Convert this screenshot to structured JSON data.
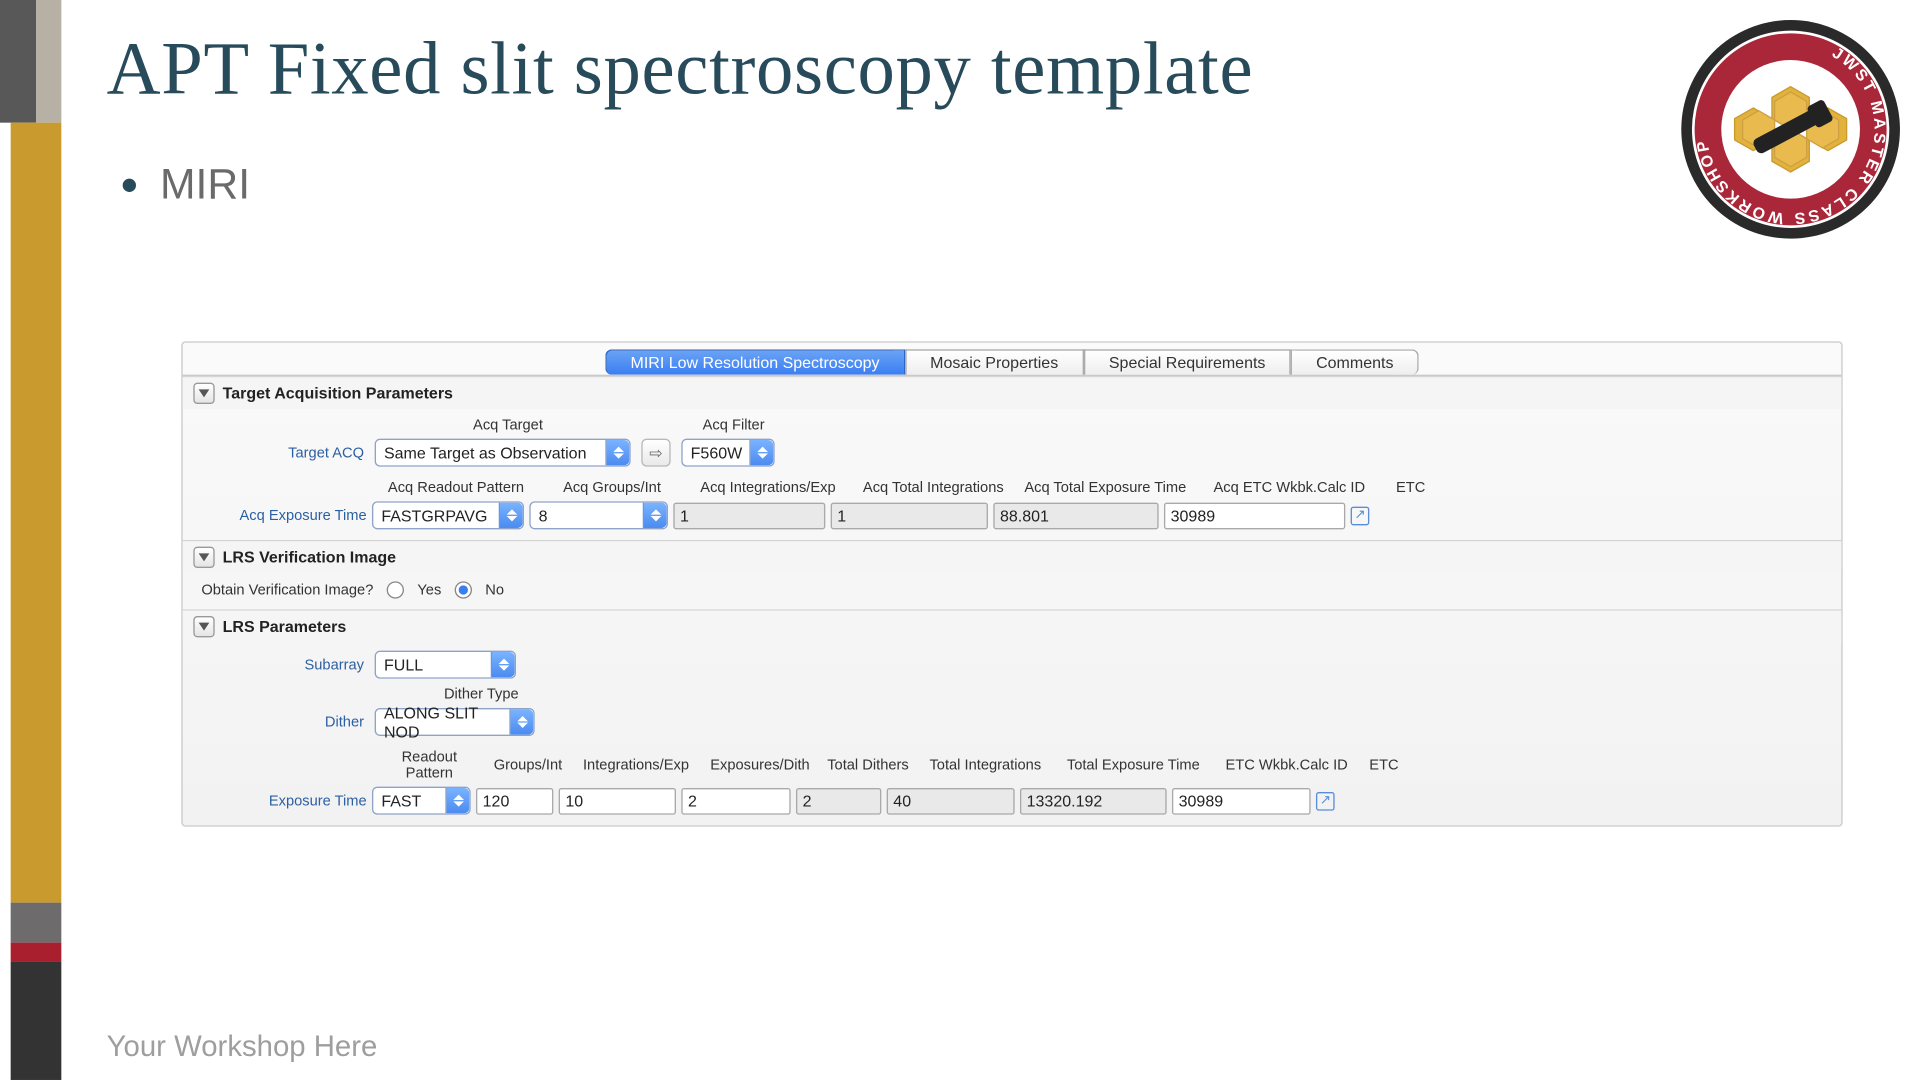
{
  "title": "APT Fixed slit spectroscopy template",
  "bullet": "MIRI",
  "footer": "Your Workshop Here",
  "logo_text": "JWST MASTER CLASS WORKSHOP",
  "tabs": {
    "main": "MIRI Low Resolution Spectroscopy",
    "mosaic": "Mosaic Properties",
    "special": "Special Requirements",
    "comments": "Comments"
  },
  "acq": {
    "section_title": "Target Acquisition Parameters",
    "target_label": "Acq Target",
    "filter_label": "Acq Filter",
    "target_acq_label": "Target ACQ",
    "target_acq_value": "Same Target as Observation",
    "filter_value": "F560W",
    "exposure_time_label": "Acq Exposure Time",
    "headers": {
      "readout": "Acq Readout Pattern",
      "groups": "Acq Groups/Int",
      "ints_exp": "Acq Integrations/Exp",
      "total_ints": "Acq Total Integrations",
      "total_exp": "Acq Total Exposure Time",
      "calc_id": "Acq ETC Wkbk.Calc ID",
      "etc": "ETC"
    },
    "values": {
      "readout": "FASTGRPAVG",
      "groups": "8",
      "ints_exp": "1",
      "total_ints": "1",
      "total_exp": "88.801",
      "calc_id": "30989"
    }
  },
  "verify": {
    "section_title": "LRS Verification Image",
    "obtain_label": "Obtain Verification Image?",
    "yes": "Yes",
    "no": "No",
    "selected": "No"
  },
  "lrs": {
    "section_title": "LRS Parameters",
    "subarray_label": "Subarray",
    "subarray_value": "FULL",
    "dither_type_label": "Dither Type",
    "dither_label": "Dither",
    "dither_value": "ALONG SLIT NOD",
    "exposure_time_label": "Exposure Time",
    "headers": {
      "readout": "Readout Pattern",
      "groups": "Groups/Int",
      "ints_exp": "Integrations/Exp",
      "exp_dith": "Exposures/Dith",
      "total_dith": "Total Dithers",
      "total_ints": "Total Integrations",
      "total_exp": "Total Exposure Time",
      "calc_id": "ETC Wkbk.Calc ID",
      "etc": "ETC"
    },
    "values": {
      "readout": "FAST",
      "groups": "120",
      "ints_exp": "10",
      "exp_dith": "2",
      "total_dith": "2",
      "total_ints": "40",
      "total_exp": "13320.192",
      "calc_id": "30989"
    }
  }
}
